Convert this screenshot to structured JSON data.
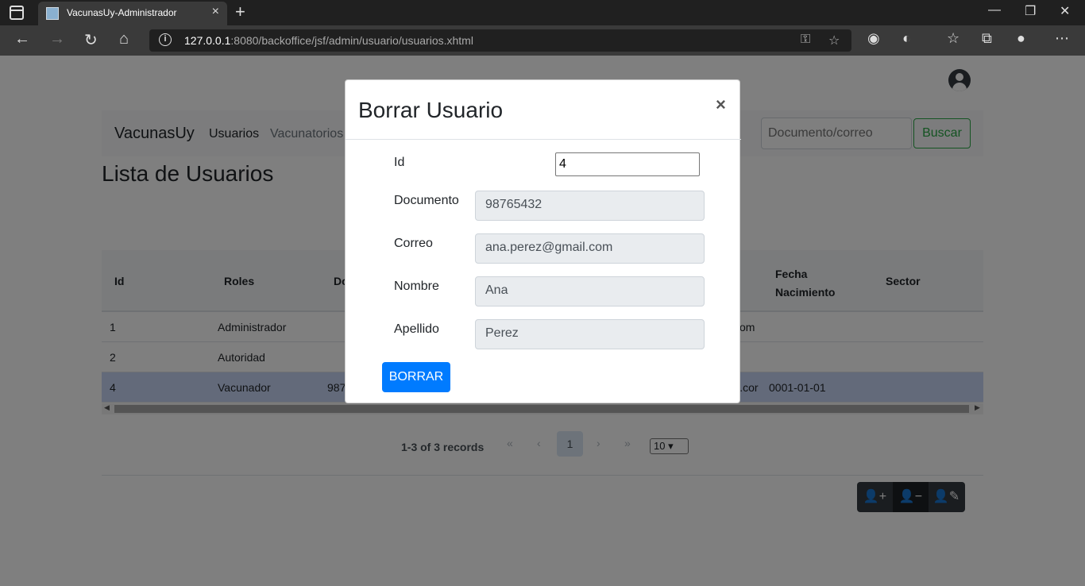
{
  "browser": {
    "tab_title": "VacunasUy-Administrador",
    "tab_close": "×",
    "new_tab": "+",
    "url_host": "127.0.0.1",
    "url_rest": ":8080/backoffice/jsf/admin/usuario/usuarios.xhtml",
    "win_minimize": "—",
    "win_restore": "❐",
    "win_close": "✕",
    "back": "←",
    "forward": "→",
    "reload": "↻",
    "home": "⌂",
    "info": "i",
    "more": "⋯"
  },
  "navbar": {
    "brand": "VacunasUy",
    "links": [
      "Usuarios",
      "Vacunatorios"
    ],
    "search_placeholder": "Documento/correo",
    "search_button": "Buscar"
  },
  "page": {
    "title": "Lista de Usuarios"
  },
  "table": {
    "headers": [
      "Id",
      "Roles",
      "Do",
      "Fecha\nNacimiento",
      "Sector"
    ],
    "rows": [
      {
        "id": "1",
        "roles": "Administrador",
        "doc": "",
        "correo_tail": "om",
        "fecha": ""
      },
      {
        "id": "2",
        "roles": "Autoridad",
        "doc": "",
        "correo_tail": "",
        "fecha": ""
      },
      {
        "id": "4",
        "roles": "Vacunador",
        "doc": "987",
        "correo_tail": "il.cor",
        "fecha": "0001-01-01"
      }
    ]
  },
  "pager": {
    "summary": "1-3 of 3 records",
    "first": "«",
    "prev": "‹",
    "current": "1",
    "next": "›",
    "last": "»",
    "per_page": "10"
  },
  "modal": {
    "title": "Borrar Usuario",
    "close": "×",
    "fields": {
      "id_label": "Id",
      "id_value": "4",
      "documento_label": "Documento",
      "documento_value": "98765432",
      "correo_label": "Correo",
      "correo_value": "ana.perez@gmail.com",
      "nombre_label": "Nombre",
      "nombre_value": "Ana",
      "apellido_label": "Apellido",
      "apellido_value": "Perez"
    },
    "delete_button": "BORRAR"
  },
  "colors": {
    "primary": "#007bff",
    "success": "#28a745",
    "selected_row": "#c7d5f5"
  }
}
